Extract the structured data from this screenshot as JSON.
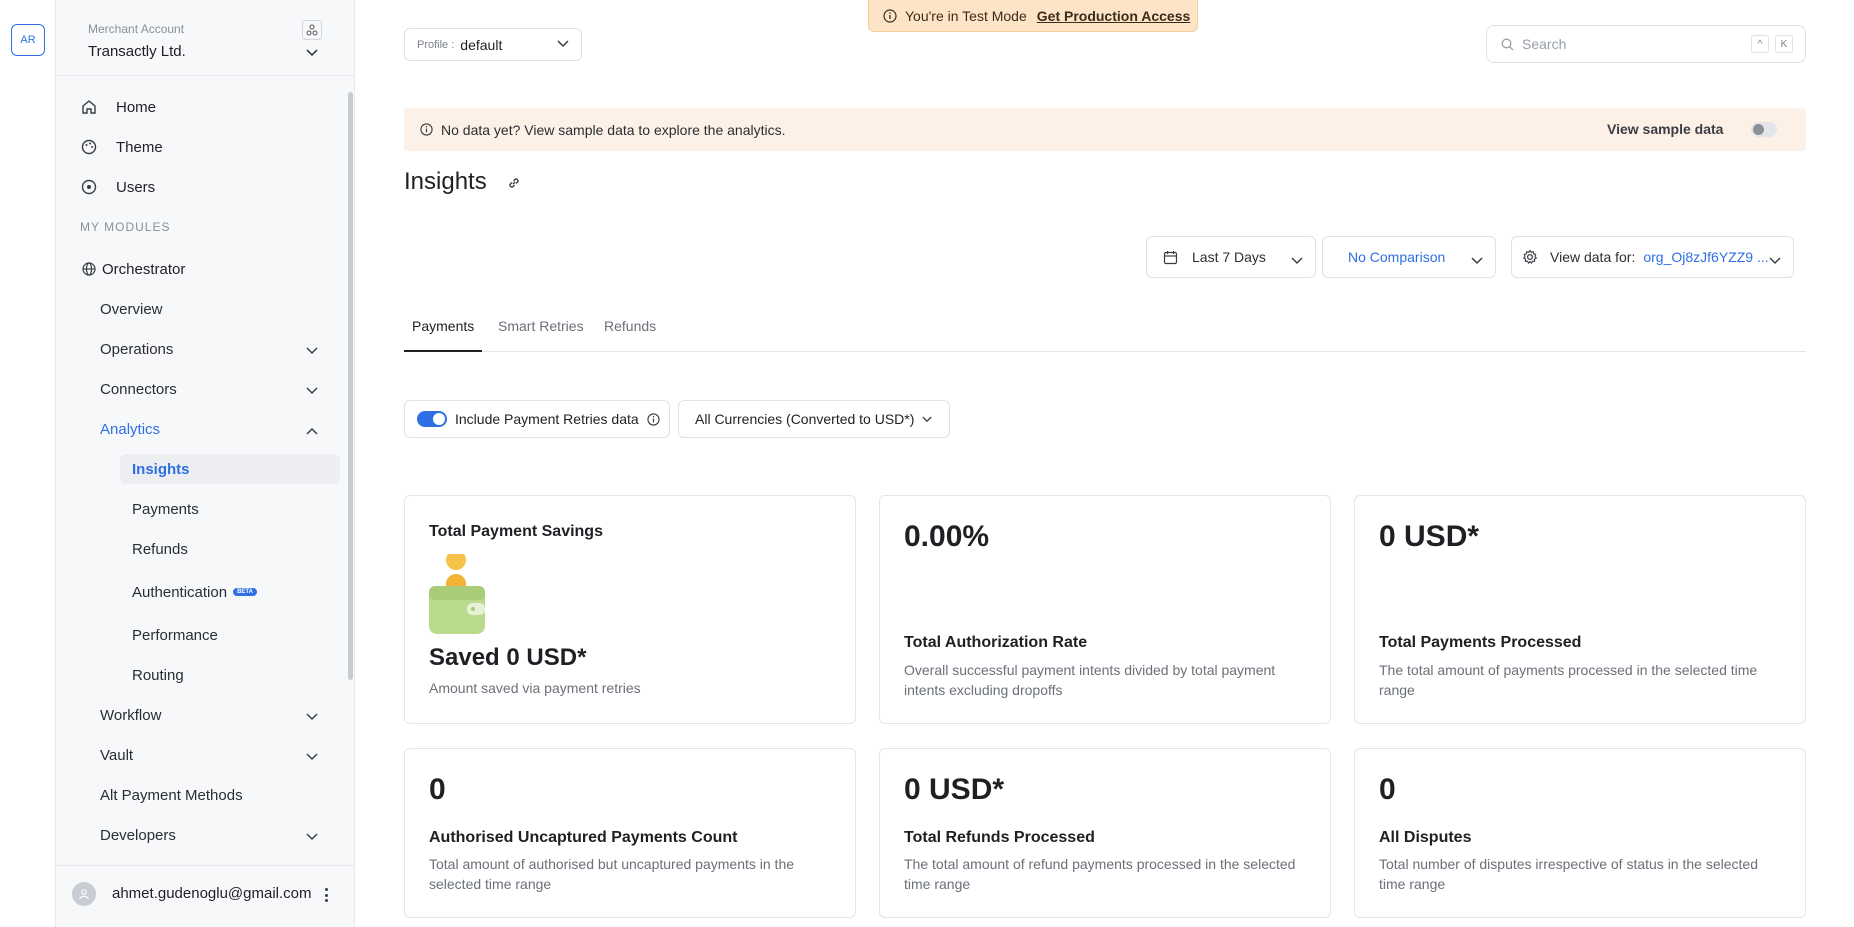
{
  "rail": {
    "org_initials": "AR"
  },
  "merchant": {
    "label": "Merchant Account",
    "name": "Transactly Ltd."
  },
  "nav": {
    "home": "Home",
    "theme": "Theme",
    "users": "Users",
    "section": "MY MODULES",
    "orchestrator": "Orchestrator",
    "overview": "Overview",
    "operations": "Operations",
    "connectors": "Connectors",
    "analytics": "Analytics",
    "analytics_items": [
      "Insights",
      "Payments",
      "Refunds",
      "Authentication",
      "Performance",
      "Routing"
    ],
    "beta": "BETA",
    "workflow": "Workflow",
    "vault": "Vault",
    "alt_payment": "Alt Payment Methods",
    "developers": "Developers"
  },
  "user": {
    "email": "ahmet.gudenoglu@gmail.com"
  },
  "banner": {
    "text": "You're in Test Mode",
    "link": "Get Production Access"
  },
  "profile": {
    "label": "Profile :",
    "value": "default"
  },
  "search": {
    "placeholder": "Search",
    "key1": "^",
    "key2": "K"
  },
  "notice": {
    "text": "No data yet? View sample data to explore the analytics.",
    "toggle_label": "View sample data"
  },
  "page": {
    "title": "Insights"
  },
  "filters": {
    "date": "Last 7 Days",
    "comparison": "No Comparison",
    "view_label": "View data for:",
    "view_value": "org_Oj8zJf6YZZ9 ..."
  },
  "tabs": [
    "Payments",
    "Smart Retries",
    "Refunds"
  ],
  "options": {
    "retries": "Include Payment Retries data",
    "currency": "All Currencies (Converted to USD*)"
  },
  "cards": [
    {
      "title": "Total Payment Savings",
      "value": "Saved 0 USD*",
      "desc": "Amount saved via payment retries"
    },
    {
      "value": "0.00%",
      "title": "Total Authorization Rate",
      "desc": "Overall successful payment intents divided by total payment intents excluding dropoffs"
    },
    {
      "value": "0 USD*",
      "title": "Total Payments Processed",
      "desc": "The total amount of payments processed in the selected time range"
    },
    {
      "value": "0",
      "title": "Authorised Uncaptured Payments Count",
      "desc": "Total amount of authorised but uncaptured payments in the selected time range"
    },
    {
      "value": "0 USD*",
      "title": "Total Refunds Processed",
      "desc": "The total amount of refund payments processed in the selected time range"
    },
    {
      "value": "0",
      "title": "All Disputes",
      "desc": "Total number of disputes irrespective of status in the selected time range"
    }
  ],
  "colors": {
    "accent": "#2f6fe4",
    "banner": "#fde4c6",
    "notice": "#fdf1e7",
    "sidebar": "#f7f8fa"
  }
}
